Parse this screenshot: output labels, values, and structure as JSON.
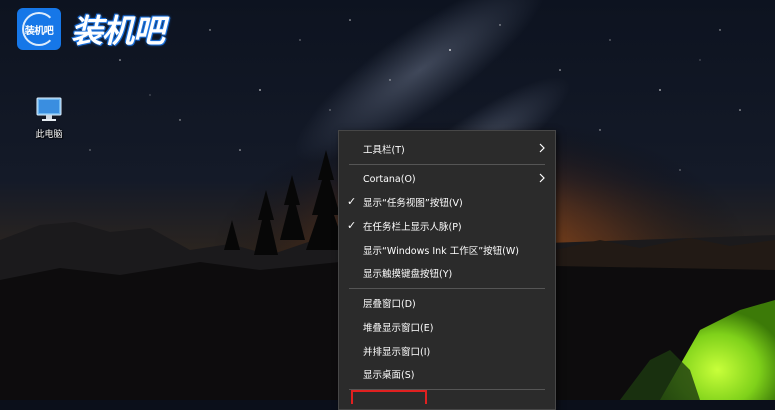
{
  "watermark": {
    "tile_text": "装机吧",
    "word": "装机吧"
  },
  "desktop": {
    "icons": [
      {
        "label": "此电脑",
        "icon": "this-pc-icon"
      }
    ]
  },
  "context_menu": {
    "items": [
      {
        "label": "工具栏(T)",
        "checked": false,
        "submenu": true
      },
      {
        "label": "Cortana(O)",
        "checked": false,
        "submenu": true
      },
      {
        "label": "显示“任务视图”按钮(V)",
        "checked": true,
        "submenu": false
      },
      {
        "label": "在任务栏上显示人脉(P)",
        "checked": true,
        "submenu": false
      },
      {
        "label": "显示“Windows Ink 工作区”按钮(W)",
        "checked": false,
        "submenu": false
      },
      {
        "label": "显示触摸键盘按钮(Y)",
        "checked": false,
        "submenu": false
      },
      {
        "label": "层叠窗口(D)",
        "checked": false,
        "submenu": false
      },
      {
        "label": "堆叠显示窗口(E)",
        "checked": false,
        "submenu": false
      },
      {
        "label": "并排显示窗口(I)",
        "checked": false,
        "submenu": false
      },
      {
        "label": "显示桌面(S)",
        "checked": false,
        "submenu": false
      }
    ],
    "check_glyph": "✓",
    "highlight_color": "#e02020"
  }
}
